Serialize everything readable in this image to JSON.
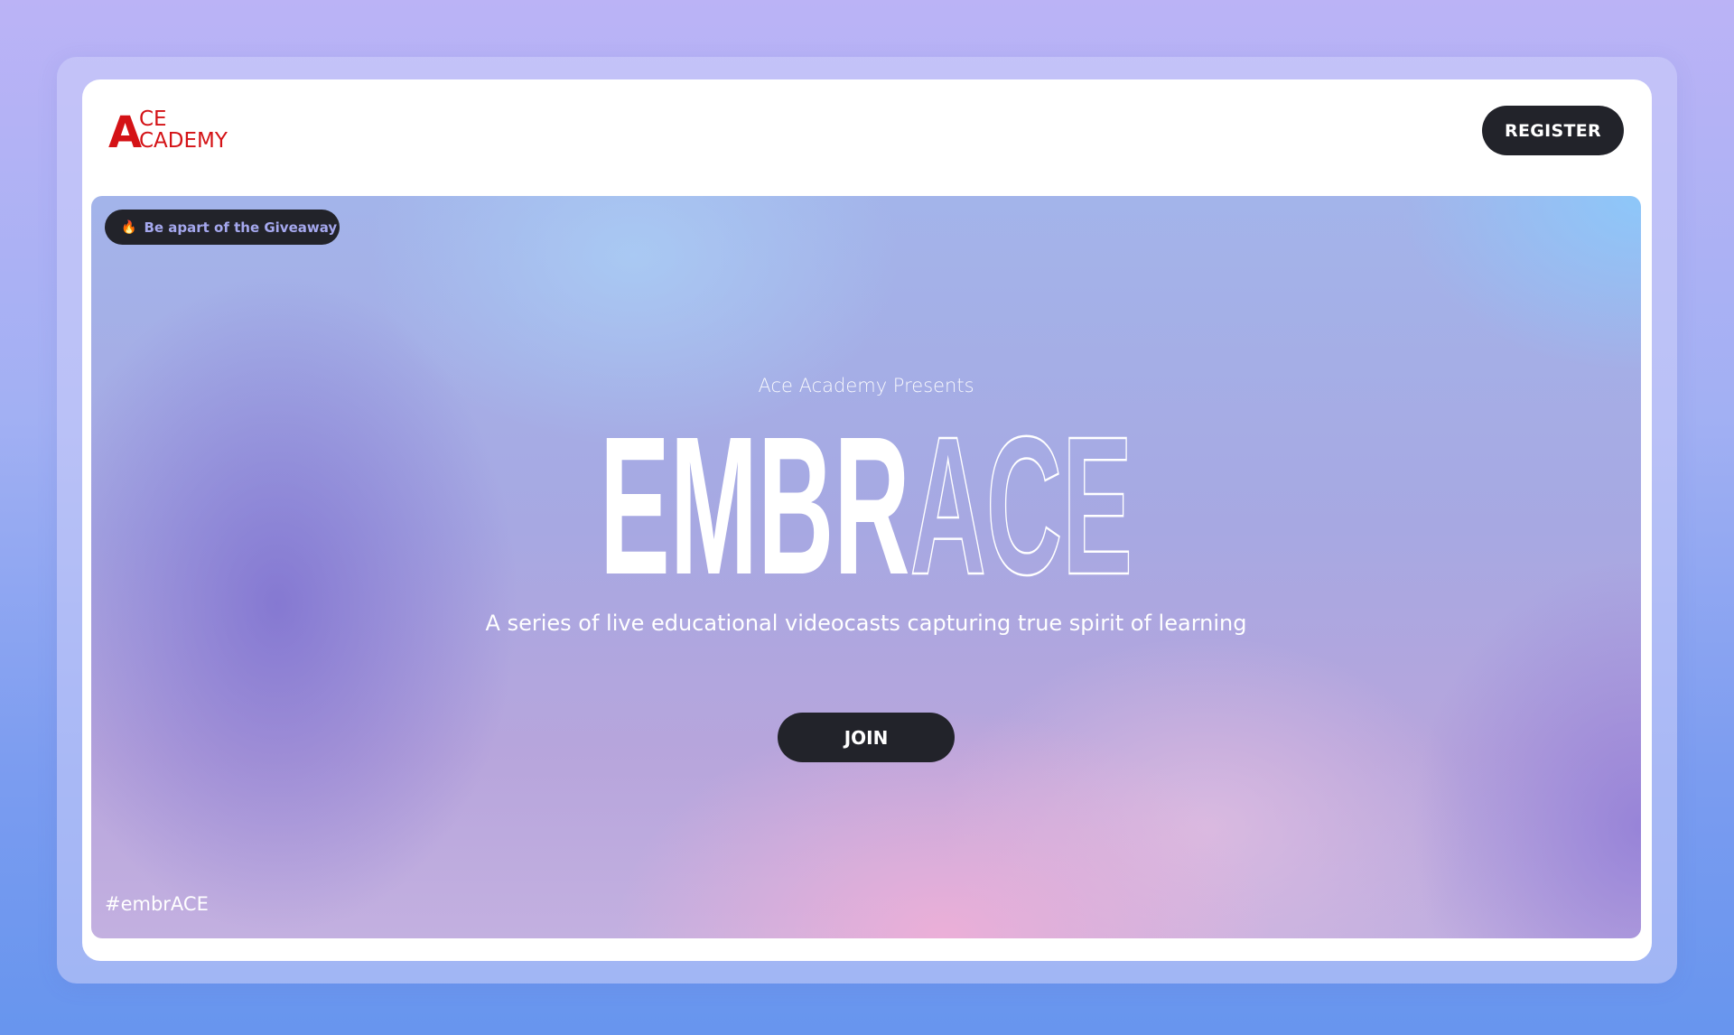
{
  "brand": {
    "logo_line1": "CE",
    "logo_line2": "CADEMY",
    "logo_letter": "A",
    "logo_color": "#d41216"
  },
  "header": {
    "register_label": "REGISTER"
  },
  "hero": {
    "badge_icon": "fire-icon",
    "badge_label": "Be apart of the Giveaway",
    "presents": "Ace Academy Presents",
    "title_solid": "EMBR",
    "title_outline": "ACE",
    "tagline": "A series of live educational videocasts capturing true spirit of learning",
    "join_label": "JOIN",
    "hashtag": "#embrACE"
  },
  "colors": {
    "button_bg": "#22232a",
    "badge_text": "#a5a8ee",
    "card_bg": "#ffffff"
  }
}
